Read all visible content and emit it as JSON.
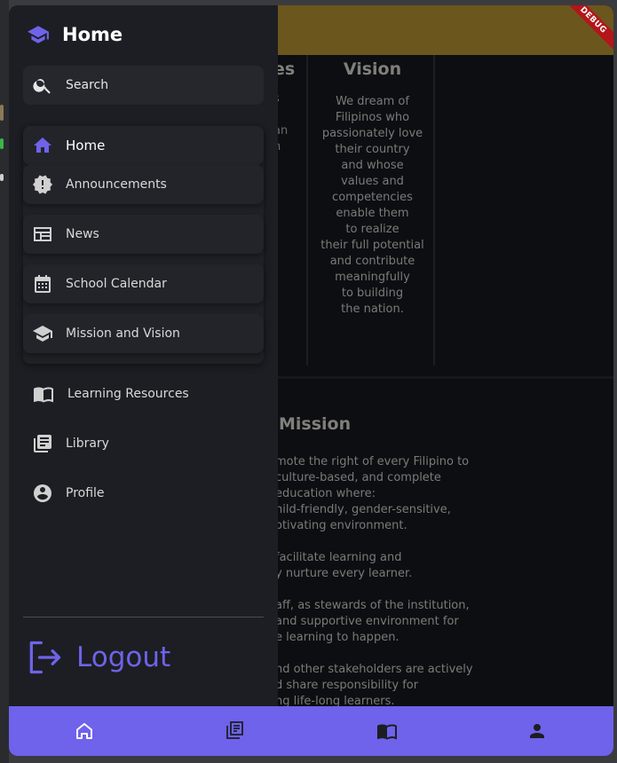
{
  "app_bar": {
    "debug_banner": "DEBUG",
    "color": "#6b561d"
  },
  "background": {
    "values_heading_fragment": "es",
    "values_text_fragments": [
      "s",
      "an",
      "n"
    ],
    "vision": {
      "title": "Vision",
      "text": "We dream of\nFilipinos who\npassionately love\ntheir country\nand whose\nvalues and\ncompetencies\nenable them\nto realize\ntheir full potential\nand contribute\nmeaningfully\nto building\nthe nation."
    },
    "mission": {
      "title": "Mission",
      "text": "mote the right of every Filipino to\n culture-based, and complete\n education where:\nhild-friendly, gender-sensitive,\notivating environment.\n\nfacilitate learning and\ny nurture every learner.\n\naff, as stewards of the institution,\nand supportive environment for\ne learning to happen.\n\nnd other stakeholders are actively\nd share responsibility for\nng life-long learners."
    }
  },
  "drawer": {
    "title": "Home",
    "title_icon": "graduation-cap-icon",
    "search": {
      "label": "Search",
      "icon": "search-icon"
    },
    "items": [
      {
        "label": "Home",
        "icon": "home-icon",
        "active": true
      },
      {
        "label": "Announcements",
        "icon": "new-releases-icon"
      },
      {
        "label": "News",
        "icon": "newspaper-icon"
      },
      {
        "label": "School Calendar",
        "icon": "calendar-icon"
      },
      {
        "label": "Mission and Vision",
        "icon": "school-icon"
      },
      {
        "label": "Learning Resources",
        "icon": "open-book-icon"
      },
      {
        "label": "Library",
        "icon": "library-books-icon"
      },
      {
        "label": "Profile",
        "icon": "account-circle-icon"
      }
    ],
    "logout": {
      "label": "Logout",
      "icon": "logout-icon"
    },
    "accent_color": "#6f63e8"
  },
  "bottom_nav": {
    "color": "#6f62eb",
    "items": [
      {
        "icon": "home-outline-icon"
      },
      {
        "icon": "library-books-icon"
      },
      {
        "icon": "open-book-icon"
      },
      {
        "icon": "person-icon"
      }
    ]
  }
}
